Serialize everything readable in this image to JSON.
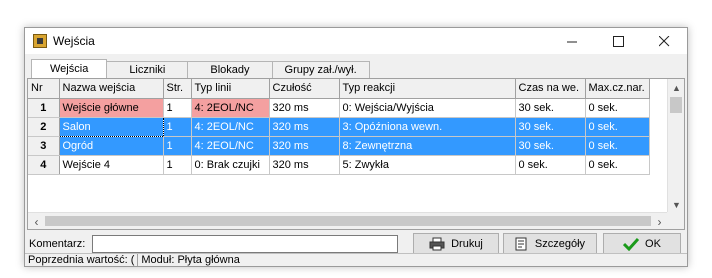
{
  "window": {
    "title": "Wejścia"
  },
  "tabs": [
    "Wejścia",
    "Liczniki",
    "Blokady",
    "Grupy zał./wył."
  ],
  "table": {
    "headers": [
      "Nr",
      "Nazwa wejścia",
      "Str.",
      "Typ linii",
      "Czułość",
      "Typ reakcji",
      "Czas na we.",
      "Max.cz.nar."
    ],
    "rows": [
      [
        "1",
        "Wejście główne",
        "1",
        "4: 2EOL/NC",
        "320 ms",
        "0: Wejścia/Wyjścia",
        "30 sek.",
        "0 sek."
      ],
      [
        "2",
        "Salon",
        "1",
        "4: 2EOL/NC",
        "320 ms",
        "3: Opóźniona wewn.",
        "30 sek.",
        "0 sek."
      ],
      [
        "3",
        "Ogród",
        "1",
        "4: 2EOL/NC",
        "320 ms",
        "8: Zewnętrzna",
        "30 sek.",
        "0 sek."
      ],
      [
        "4",
        "Wejście  4",
        "1",
        "0: Brak czujki",
        "320 ms",
        "5: Zwykła",
        "0 sek.",
        "0 sek."
      ]
    ]
  },
  "bottom": {
    "komentarz_label": "Komentarz:",
    "komentarz_value": "",
    "print_label": "Drukuj",
    "details_label": "Szczegóły",
    "ok_label": "OK"
  },
  "status": {
    "previous_value": "Poprzednia wartość: (",
    "module": "Moduł: Płyta główna"
  },
  "colors": {
    "selection": "#3399ff",
    "error_cell": "#f4a0a0"
  }
}
